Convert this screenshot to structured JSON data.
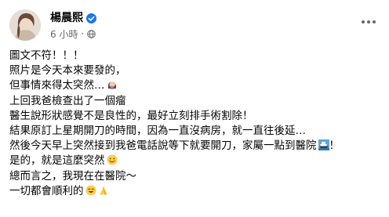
{
  "post": {
    "author": "楊晨熙",
    "time": "6 小時",
    "separator": "·",
    "verified_icon": "verified-badge-icon",
    "privacy_icon": "globe-icon",
    "lines": [
      {
        "text": "圖文不符！！！"
      },
      {
        "text": "照片是今天本來要發的，"
      },
      {
        "text": "但事情來得太突然…",
        "emoji": "woman-face-palm-icon"
      },
      {
        "text": "上回我爸檢查出了一個瘤"
      },
      {
        "text": "醫生說形狀感覺不是良性的，最好立刻排手術割除！"
      },
      {
        "text": "結果原訂上星期開刀的時間，因為一直沒病房，就一直往後延…"
      },
      {
        "text": "然後今天早上突然接到我爸電話說等下就要開刀，家屬一點到醫院",
        "emoji": "ship-icon",
        "after": "！"
      },
      {
        "text": "是的，就是這麼突然",
        "emoji": "smiling-face-icon"
      },
      {
        "text": "總而言之，我現在在醫院～"
      },
      {
        "text": "一切都會順利的",
        "emoji": "grinning-face-icon",
        "emoji2": "folded-hands-icon"
      }
    ]
  },
  "colors": {
    "text": "#050505",
    "meta": "#65676b",
    "verified": "#1877f2"
  }
}
